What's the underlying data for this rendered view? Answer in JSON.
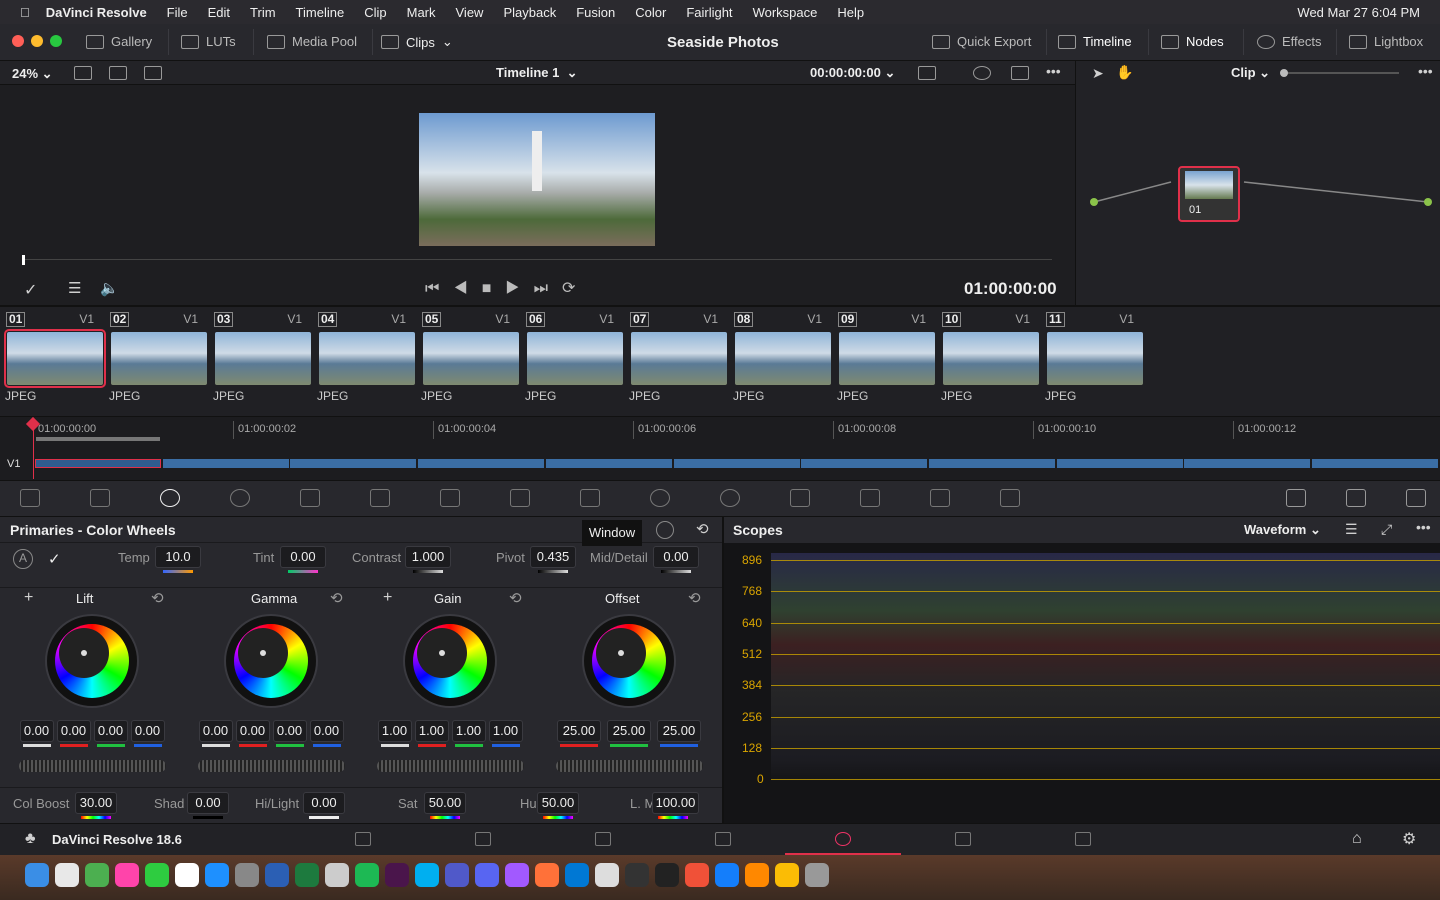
{
  "menubar": {
    "items": [
      "DaVinci Resolve",
      "File",
      "Edit",
      "Trim",
      "Timeline",
      "Clip",
      "Mark",
      "View",
      "Playback",
      "Fusion",
      "Color",
      "Fairlight",
      "Workspace",
      "Help"
    ],
    "datetime": "Wed Mar 27  6:04 PM"
  },
  "titlebar": {
    "gallery": "Gallery",
    "luts": "LUTs",
    "media_pool": "Media Pool",
    "clips": "Clips",
    "project": "Seaside Photos",
    "quick_export": "Quick Export",
    "timeline": "Timeline",
    "nodes": "Nodes",
    "effects": "Effects",
    "lightbox": "Lightbox"
  },
  "viewer": {
    "zoom": "24%",
    "timeline_name": "Timeline 1",
    "timecode_top": "00:00:00:00",
    "timecode": "01:00:00:00"
  },
  "nodes": {
    "mode": "Clip",
    "node_label": "01"
  },
  "clips": [
    {
      "n": "01",
      "t": "V1",
      "f": "JPEG"
    },
    {
      "n": "02",
      "t": "V1",
      "f": "JPEG"
    },
    {
      "n": "03",
      "t": "V1",
      "f": "JPEG"
    },
    {
      "n": "04",
      "t": "V1",
      "f": "JPEG"
    },
    {
      "n": "05",
      "t": "V1",
      "f": "JPEG"
    },
    {
      "n": "06",
      "t": "V1",
      "f": "JPEG"
    },
    {
      "n": "07",
      "t": "V1",
      "f": "JPEG"
    },
    {
      "n": "08",
      "t": "V1",
      "f": "JPEG"
    },
    {
      "n": "09",
      "t": "V1",
      "f": "JPEG"
    },
    {
      "n": "10",
      "t": "V1",
      "f": "JPEG"
    },
    {
      "n": "11",
      "t": "V1",
      "f": "JPEG"
    }
  ],
  "ruler": [
    "01:00:00:00",
    "01:00:00:02",
    "01:00:00:04",
    "01:00:00:06",
    "01:00:00:08",
    "01:00:00:10",
    "01:00:00:12"
  ],
  "track": "V1",
  "tooltip": "Window",
  "primaries": {
    "title": "Primaries - Color Wheels",
    "top": [
      {
        "l": "Temp",
        "v": "10.0"
      },
      {
        "l": "Tint",
        "v": "0.00"
      },
      {
        "l": "Contrast",
        "v": "1.000"
      },
      {
        "l": "Pivot",
        "v": "0.435"
      },
      {
        "l": "Mid/Detail",
        "v": "0.00"
      }
    ],
    "wheels": [
      {
        "name": "Lift",
        "vals": [
          "0.00",
          "0.00",
          "0.00",
          "0.00"
        ]
      },
      {
        "name": "Gamma",
        "vals": [
          "0.00",
          "0.00",
          "0.00",
          "0.00"
        ]
      },
      {
        "name": "Gain",
        "vals": [
          "1.00",
          "1.00",
          "1.00",
          "1.00"
        ]
      },
      {
        "name": "Offset",
        "vals": [
          "25.00",
          "25.00",
          "25.00"
        ]
      }
    ],
    "bottom": [
      {
        "l": "Col Boost",
        "v": "30.00"
      },
      {
        "l": "Shad",
        "v": "0.00"
      },
      {
        "l": "Hi/Light",
        "v": "0.00"
      },
      {
        "l": "Sat",
        "v": "50.00"
      },
      {
        "l": "Hue",
        "v": "50.00"
      },
      {
        "l": "L. Mix",
        "v": "100.00"
      }
    ]
  },
  "scopes": {
    "title": "Scopes",
    "type": "Waveform",
    "scale": [
      "896",
      "768",
      "640",
      "512",
      "384",
      "256",
      "128",
      "0"
    ],
    "line_color": "#c8a000"
  },
  "pages": {
    "app_version": "DaVinci Resolve 18.6",
    "active": "Color",
    "accent": "#e0304a"
  },
  "dock": {
    "apps": [
      "finder",
      "launchpad",
      "maps",
      "photos",
      "facetime",
      "calendar",
      "app-store",
      "settings",
      "word",
      "excel",
      "script-editor",
      "spotify",
      "slack",
      "skype",
      "teams",
      "discord",
      "figma",
      "firefox",
      "vscode",
      "textedit",
      "github",
      "terminal",
      "swift",
      "xcode",
      "vlc",
      "chrome",
      "trash"
    ]
  }
}
